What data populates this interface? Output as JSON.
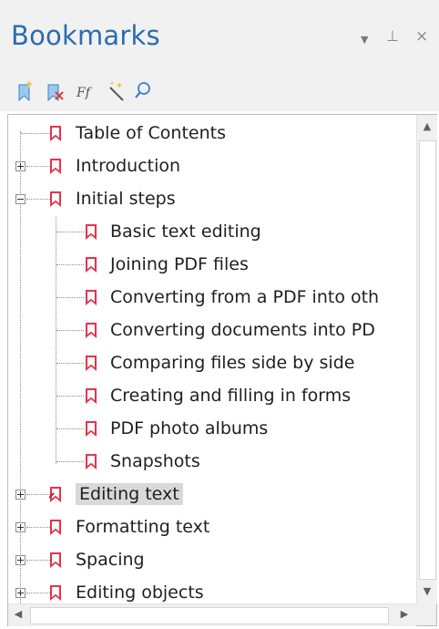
{
  "panel": {
    "title": "Bookmarks",
    "controls": {
      "menu": "▼",
      "pin": "⊥",
      "close": "×"
    }
  },
  "toolbar": {
    "buttons": [
      {
        "name": "new-bookmark",
        "icon": "new-bookmark-icon"
      },
      {
        "name": "delete-bookmark",
        "icon": "delete-bookmark-icon"
      },
      {
        "name": "font-format",
        "icon": "font-format-icon"
      },
      {
        "name": "magic-wand",
        "icon": "magic-wand-icon"
      },
      {
        "name": "find",
        "icon": "search-icon"
      }
    ]
  },
  "tree": {
    "items": [
      {
        "label": "Table of Contents"
      },
      {
        "label": "Introduction"
      },
      {
        "label": "Initial steps"
      },
      {
        "label": "Basic text editing"
      },
      {
        "label": "Joining PDF files"
      },
      {
        "label": "Converting from a PDF into oth"
      },
      {
        "label": "Converting documents into PD"
      },
      {
        "label": "Comparing files side by side"
      },
      {
        "label": "Creating and filling in forms"
      },
      {
        "label": "PDF photo albums"
      },
      {
        "label": "Snapshots"
      },
      {
        "label": "Editing text"
      },
      {
        "label": "Formatting text"
      },
      {
        "label": "Spacing"
      },
      {
        "label": "Editing objects"
      }
    ]
  },
  "scroll": {
    "up": "▲",
    "down": "▼",
    "left": "◀",
    "right": "▶"
  },
  "colors": {
    "bookmark": "#e8324a",
    "title": "#2b6cb0",
    "selected": "#d9d9d9"
  }
}
